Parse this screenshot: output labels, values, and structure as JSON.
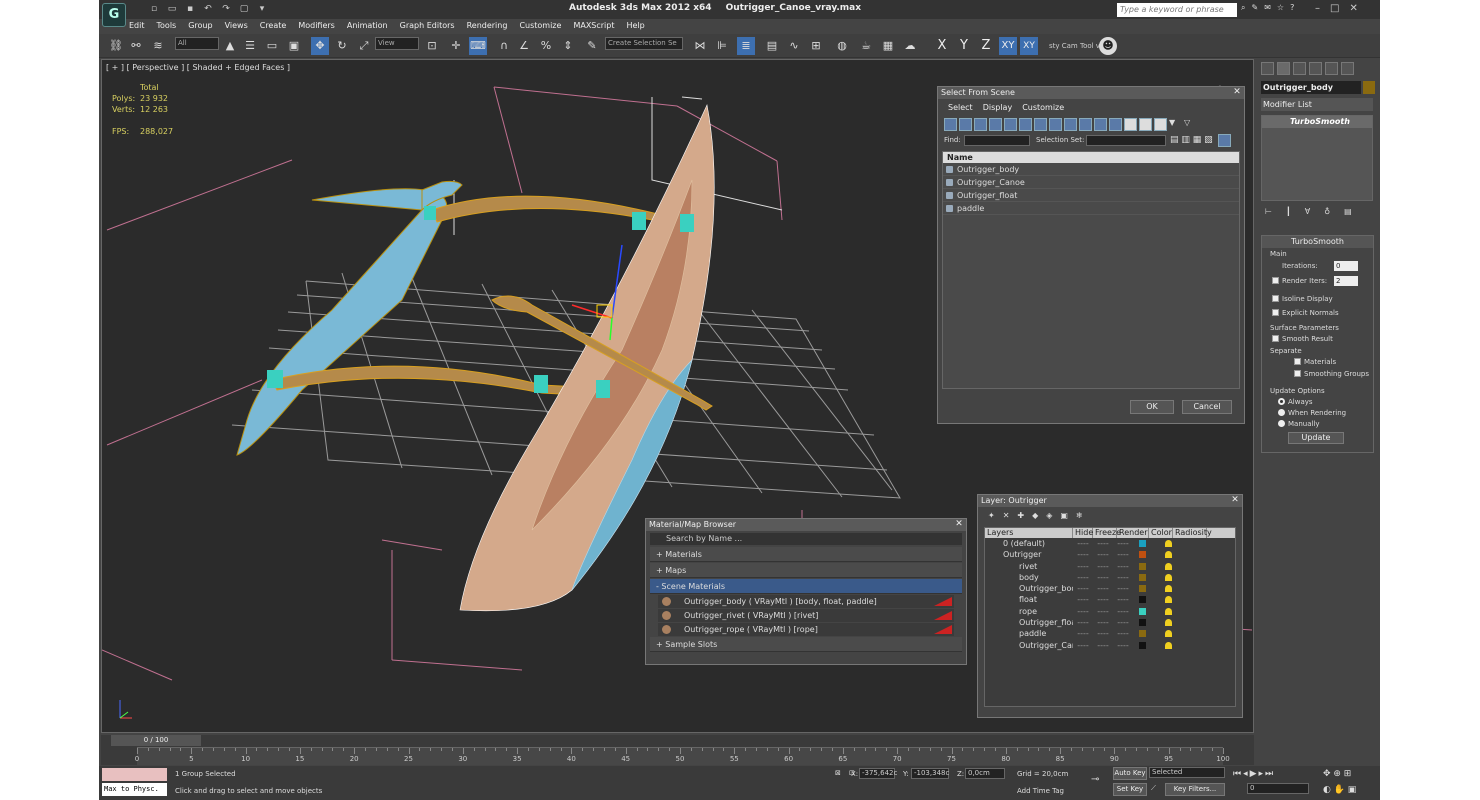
{
  "window": {
    "app": "Autodesk 3ds Max  2012 x64",
    "file": "Outrigger_Canoe_vray.max",
    "search_placeholder": "Type a keyword or phrase",
    "logo": "G"
  },
  "menu": [
    "Edit",
    "Tools",
    "Group",
    "Views",
    "Create",
    "Modifiers",
    "Animation",
    "Graph Editors",
    "Rendering",
    "Customize",
    "MAXScript",
    "Help"
  ],
  "toolbar": {
    "filter": "All",
    "refcoord": "View",
    "selset": "Create Selection Se",
    "axes": [
      "X",
      "Y",
      "Z",
      "XY",
      "XY"
    ],
    "cam_tool": "sty Cam Tool v"
  },
  "viewport": {
    "label": "[ + ] [ Perspective ] [ Shaded + Edged Faces ]",
    "stats": {
      "total_label": "Total",
      "polys_label": "Polys:",
      "polys": "23 932",
      "verts_label": "Verts:",
      "verts": "12 263",
      "fps_label": "FPS:",
      "fps": "288,027"
    }
  },
  "select_from_scene": {
    "title": "Select From Scene",
    "menu": [
      "Select",
      "Display",
      "Customize"
    ],
    "find_label": "Find:",
    "selset_label": "Selection Set:",
    "col_name": "Name",
    "items": [
      "Outrigger_body",
      "Outrigger_Canoe",
      "Outrigger_float",
      "paddle"
    ],
    "ok": "OK",
    "cancel": "Cancel"
  },
  "material_browser": {
    "title": "Material/Map Browser",
    "search": "Search by Name ...",
    "sections": [
      "+ Materials",
      "+ Maps",
      "- Scene Materials"
    ],
    "items": [
      "Outrigger_body  ( VRayMtl ) [body, float, paddle]",
      "Outrigger_rivet  ( VRayMtl ) [rivet]",
      "Outrigger_rope  ( VRayMtl ) [rope]"
    ],
    "sample": "+ Sample Slots"
  },
  "layer_window": {
    "title": "Layer: Outrigger",
    "cols": [
      "Layers",
      "Hide",
      "Freeze",
      "Render",
      "Color",
      "Radiosity"
    ],
    "rows": [
      {
        "name": "0 (default)",
        "child": false,
        "color": "#1aa0c0"
      },
      {
        "name": "Outrigger",
        "child": false,
        "color": "#c05010"
      },
      {
        "name": "rivet",
        "child": true,
        "color": "#8a6a10"
      },
      {
        "name": "body",
        "child": true,
        "color": "#8a6a10"
      },
      {
        "name": "Outrigger_body",
        "child": true,
        "color": "#8a6a10"
      },
      {
        "name": "float",
        "child": true,
        "color": "#111111"
      },
      {
        "name": "rope",
        "child": true,
        "color": "#3ad0c0"
      },
      {
        "name": "Outrigger_float",
        "child": true,
        "color": "#111111"
      },
      {
        "name": "paddle",
        "child": true,
        "color": "#8a6a10"
      },
      {
        "name": "Outrigger_Canoe",
        "child": true,
        "color": "#111111"
      }
    ],
    "dash": "----"
  },
  "command_panel": {
    "object_name": "Outrigger_body",
    "modifier_list": "Modifier List",
    "stack_item": "TurboSmooth",
    "rollout": "TurboSmooth",
    "main": "Main",
    "iterations_label": "Iterations:",
    "iterations": "0",
    "render_iters_label": "Render Iters:",
    "render_iters": "2",
    "isoline": "Isoline Display",
    "explicit": "Explicit Normals",
    "surface": "Surface Parameters",
    "smooth": "Smooth Result",
    "separate": "Separate",
    "materials": "Materials",
    "smoothing": "Smoothing Groups",
    "update_opts": "Update Options",
    "always": "Always",
    "when_rendering": "When Rendering",
    "manually": "Manually",
    "update": "Update"
  },
  "timeline": {
    "frame": "0 / 100",
    "ticks": [
      "0",
      "5",
      "10",
      "15",
      "20",
      "25",
      "30",
      "35",
      "40",
      "45",
      "50",
      "55",
      "60",
      "65",
      "70",
      "75",
      "80",
      "85",
      "90",
      "95",
      "100"
    ]
  },
  "status": {
    "maxscript": "Max to Physc.",
    "selected": "1 Group Selected",
    "prompt": "Click and drag to select and move objects",
    "x_label": "X:",
    "x": "-375,642c",
    "y_label": "Y:",
    "y": "-103,348c",
    "z_label": "Z:",
    "z": "0,0cm",
    "grid": "Grid = 20,0cm",
    "add_time_tag": "Add Time Tag",
    "auto_key": "Auto Key",
    "set_key": "Set Key",
    "key_mode": "Selected",
    "key_filters": "Key Filters...",
    "frame": "0"
  }
}
